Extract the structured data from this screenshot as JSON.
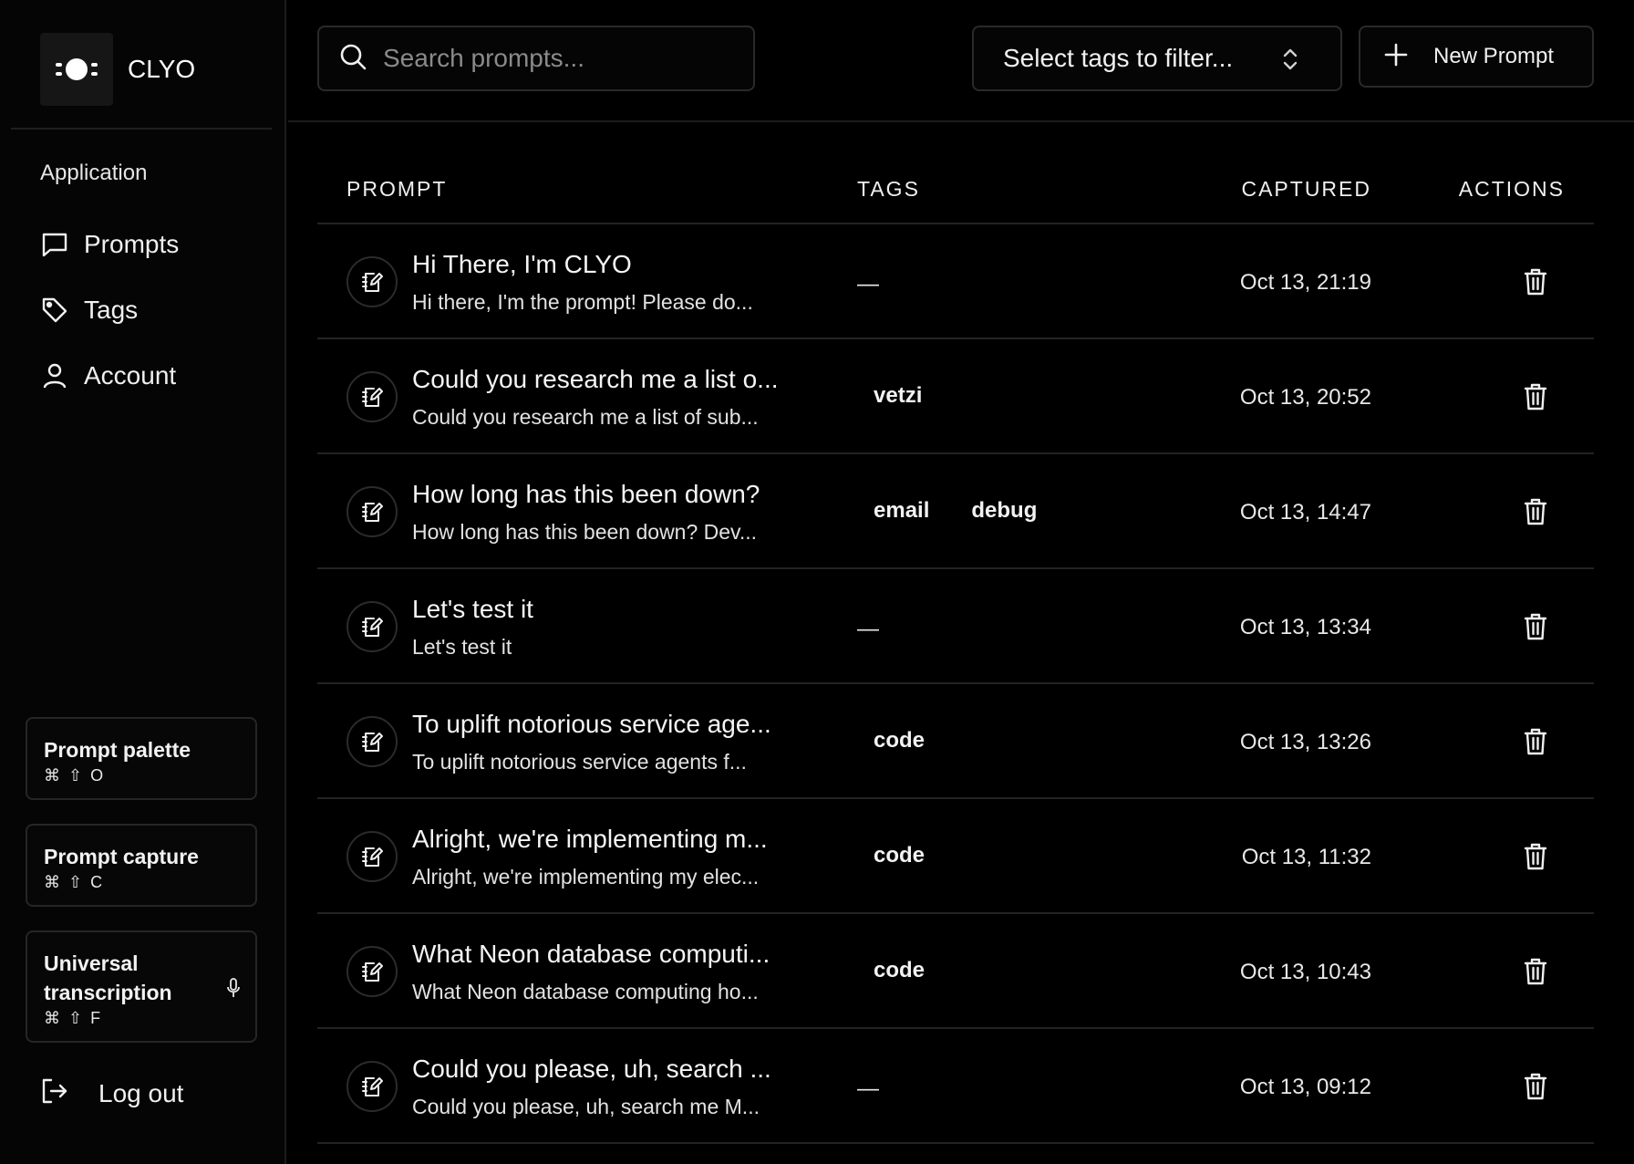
{
  "app": {
    "name": "CLYO",
    "logo_icon": "clyo-logo-icon"
  },
  "sidebar": {
    "section_label": "Application",
    "items": [
      {
        "label": "Prompts",
        "icon": "chat-bubble-icon"
      },
      {
        "label": "Tags",
        "icon": "tag-icon"
      },
      {
        "label": "Account",
        "icon": "user-icon"
      }
    ],
    "shortcuts": [
      {
        "title": "Prompt palette",
        "keys": "⌘ ⇧ O"
      },
      {
        "title": "Prompt capture",
        "keys": "⌘ ⇧ C"
      },
      {
        "title": "Universal transcription",
        "keys": "⌘ ⇧ F",
        "icon": "microphone-icon"
      }
    ],
    "logout_label": "Log out"
  },
  "toolbar": {
    "search_placeholder": "Search prompts...",
    "tag_filter_label": "Select tags to filter...",
    "new_prompt_label": "New Prompt"
  },
  "table": {
    "headers": {
      "prompt": "PROMPT",
      "tags": "TAGS",
      "captured": "CAPTURED",
      "actions": "ACTIONS"
    },
    "empty_tag": "—",
    "rows": [
      {
        "title": "Hi There, I'm CLYO",
        "preview": "Hi there, I'm the prompt! Please do...",
        "tags": [],
        "captured": "Oct 13, 21:19"
      },
      {
        "title": "Could you research me a list o...",
        "preview": "Could you research me a list of sub...",
        "tags": [
          "vetzi"
        ],
        "captured": "Oct 13, 20:52"
      },
      {
        "title": "How long has this been down?",
        "preview": "How long has this been down? Dev...",
        "tags": [
          "email",
          "debug"
        ],
        "captured": "Oct 13, 14:47"
      },
      {
        "title": "Let's test it",
        "preview": "Let's test it",
        "tags": [],
        "captured": "Oct 13, 13:34"
      },
      {
        "title": "To uplift notorious service age...",
        "preview": "To uplift notorious service agents f...",
        "tags": [
          "code"
        ],
        "captured": "Oct 13, 13:26"
      },
      {
        "title": "Alright, we're implementing m...",
        "preview": "Alright, we're implementing my elec...",
        "tags": [
          "code"
        ],
        "captured": "Oct 13, 11:32"
      },
      {
        "title": "What Neon database computi...",
        "preview": "What Neon database computing ho...",
        "tags": [
          "code"
        ],
        "captured": "Oct 13, 10:43"
      },
      {
        "title": "Could you please, uh, search ...",
        "preview": "Could you please, uh, search me M...",
        "tags": [],
        "captured": "Oct 13, 09:12"
      }
    ]
  }
}
